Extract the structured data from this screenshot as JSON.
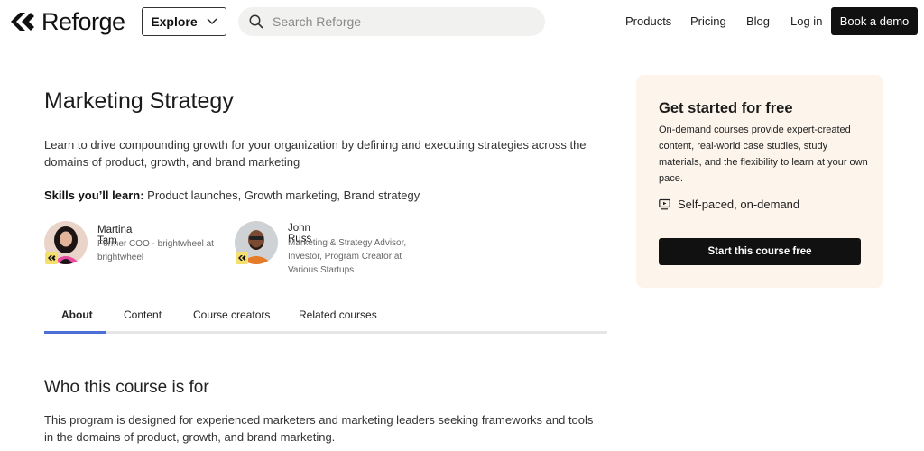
{
  "header": {
    "logo_text": "Reforge",
    "explore_label": "Explore",
    "search_placeholder": "Search Reforge",
    "nav": [
      "Products",
      "Pricing",
      "Blog",
      "Log in"
    ],
    "demo_label": "Book a demo"
  },
  "course": {
    "title": "Marketing Strategy",
    "description": "Learn to drive compounding growth for your organization by defining and executing strategies across the domains of product, growth, and brand marketing",
    "skills_label": "Skills you’ll learn:",
    "skills": " Product launches, Growth marketing, Brand strategy"
  },
  "creators": [
    {
      "name": "Martina Tam",
      "role": "Former COO - brightwheel at brightwheel"
    },
    {
      "name": "John Russ",
      "role": "Marketing & Strategy Advisor, Investor, Program Creator at Various Startups"
    }
  ],
  "tabs": [
    "About",
    "Content",
    "Course creators",
    "Related courses"
  ],
  "active_tab": "About",
  "section": {
    "title": "Who this course is for",
    "text": "This program is designed for experienced marketers and marketing leaders seeking frameworks and tools in the domains of product, growth, and brand marketing."
  },
  "card": {
    "title": "Get started for free",
    "text": "On-demand courses provide expert-created content, real-world case studies, study materials, and the flexibility to learn at your own pace.",
    "feature": "Self-paced, on-demand",
    "button_label": "Start this course free"
  },
  "colors": {
    "accent": "#4f6fd8",
    "card_bg": "#fdf5ec",
    "button_bg": "#111111",
    "badge": "#f5e06e"
  },
  "icons": [
    "reforge-logo-icon",
    "chevron-down-icon",
    "search-icon",
    "monitor-play-icon",
    "reforge-badge-icon"
  ]
}
